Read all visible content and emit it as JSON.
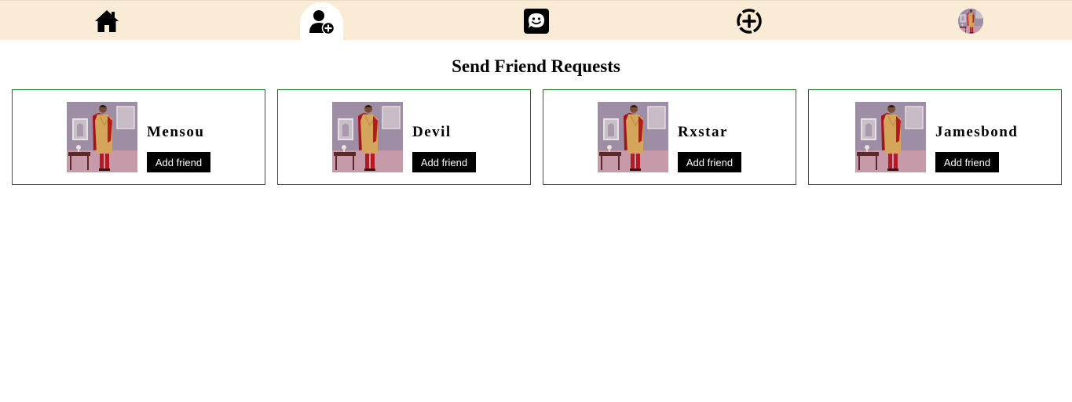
{
  "nav": {
    "items": [
      {
        "icon": "home-icon"
      },
      {
        "icon": "add-friend-icon",
        "active": true
      },
      {
        "icon": "chat-icon"
      },
      {
        "icon": "create-post-icon"
      },
      {
        "icon": "profile-avatar"
      }
    ]
  },
  "page": {
    "title": "Send Friend Requests"
  },
  "suggestions": [
    {
      "name": "Mensou",
      "button": "Add friend"
    },
    {
      "name": "Devil",
      "button": "Add friend"
    },
    {
      "name": "Rxstar",
      "button": "Add friend"
    },
    {
      "name": "Jamesbond",
      "button": "Add friend"
    }
  ],
  "colors": {
    "navbar_bg": "#faebd7",
    "card_border": "#0a7a0a",
    "button_bg": "#000000",
    "button_text": "#ffffff"
  }
}
